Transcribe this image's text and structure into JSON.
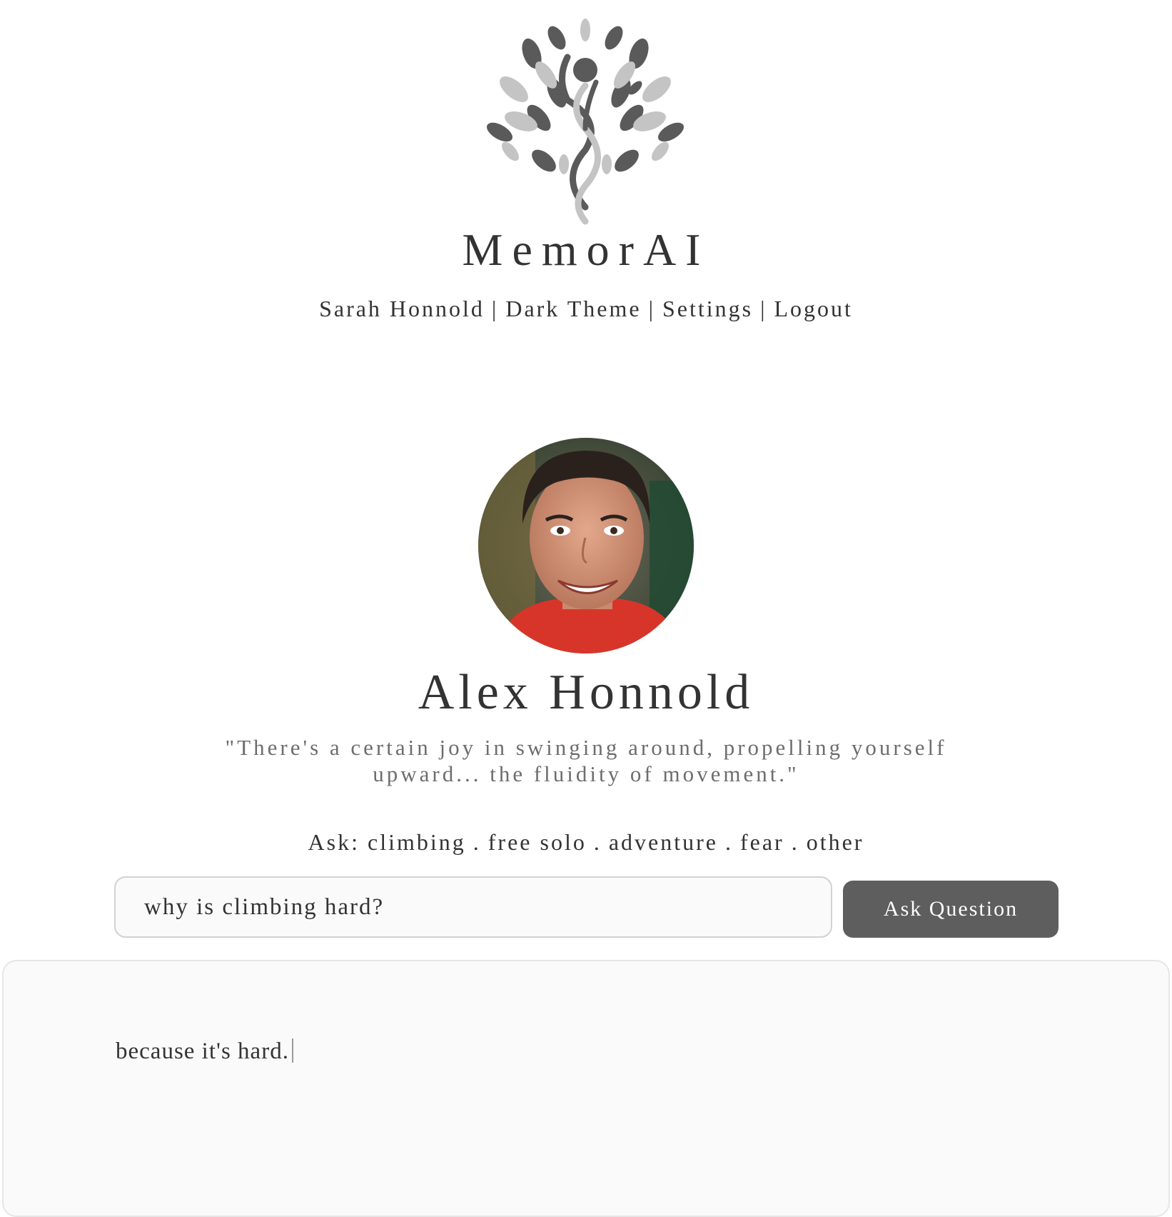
{
  "header": {
    "brand": "MemorAI",
    "logo_icon": "tree-dna-logo-icon",
    "nav": {
      "user": "Sarah Honnold",
      "theme": "Dark Theme",
      "settings": "Settings",
      "logout": "Logout",
      "separator": "|"
    }
  },
  "profile": {
    "name": "Alex Honnold",
    "quote": "\"There's a certain joy in swinging around, propelling yourself upward... the fluidity of movement.\"",
    "portrait_icon": "portrait-photo"
  },
  "ask": {
    "prefix": "Ask:",
    "separator": ".",
    "topics": [
      "climbing",
      "free solo",
      "adventure",
      "fear",
      "other"
    ]
  },
  "question": {
    "value": "why is climbing hard?",
    "button_label": "Ask Question"
  },
  "answer": {
    "text": "because it's hard."
  },
  "colors": {
    "text": "#333333",
    "muted": "#6d6d6d",
    "button": "#5e5e5e",
    "panel": "#fafafa",
    "border": "#d2d2d2"
  }
}
